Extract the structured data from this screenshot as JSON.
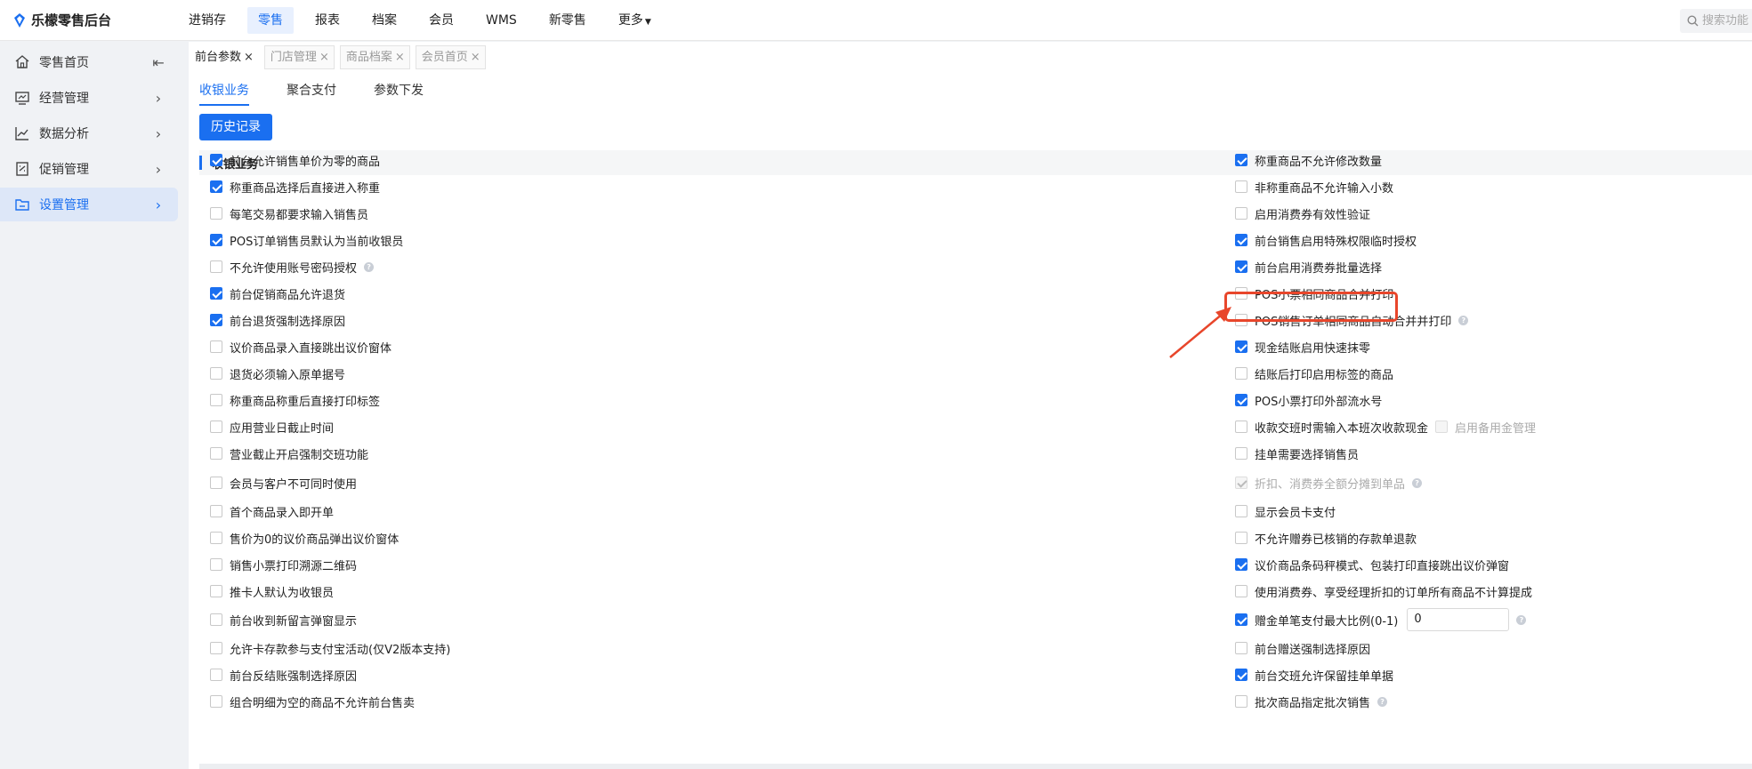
{
  "app": {
    "title": "乐檬零售后台"
  },
  "topnav": [
    {
      "label": "进销存",
      "active": false
    },
    {
      "label": "零售",
      "active": true
    },
    {
      "label": "报表",
      "active": false
    },
    {
      "label": "档案",
      "active": false
    },
    {
      "label": "会员",
      "active": false
    },
    {
      "label": "WMS",
      "active": false
    },
    {
      "label": "新零售",
      "active": false
    },
    {
      "label": "更多",
      "active": false
    }
  ],
  "search": {
    "placeholder": "搜索功能"
  },
  "sidebar": {
    "items": [
      {
        "label": "零售首页",
        "icon": "home-icon"
      },
      {
        "label": "经营管理",
        "icon": "monitor-icon"
      },
      {
        "label": "数据分析",
        "icon": "chart-line-icon"
      },
      {
        "label": "促销管理",
        "icon": "promotion-icon"
      },
      {
        "label": "设置管理",
        "icon": "folder-settings-icon"
      }
    ]
  },
  "page_tabs": [
    {
      "label": "前台参数",
      "active": true
    },
    {
      "label": "门店管理",
      "active": false
    },
    {
      "label": "商品档案",
      "active": false
    },
    {
      "label": "会员首页",
      "active": false
    }
  ],
  "sub_tabs": [
    {
      "label": "收银业务",
      "active": true
    },
    {
      "label": "聚合支付",
      "active": false
    },
    {
      "label": "参数下发",
      "active": false
    }
  ],
  "history_button": "历史记录",
  "section_title": "收银业务",
  "left_settings": [
    {
      "label": "前台允许销售单价为零的商品",
      "checked": true
    },
    {
      "label": "称重商品选择后直接进入称重",
      "checked": true
    },
    {
      "label": "每笔交易都要求输入销售员",
      "checked": false
    },
    {
      "label": "POS订单销售员默认为当前收银员",
      "checked": true
    },
    {
      "label": "不允许使用账号密码授权",
      "checked": false
    },
    {
      "label": "前台促销商品允许退货",
      "checked": true
    },
    {
      "label": "前台退货强制选择原因",
      "checked": true
    },
    {
      "label": "议价商品录入直接跳出议价窗体",
      "checked": false
    },
    {
      "label": "退货必须输入原单据号",
      "checked": false
    },
    {
      "label": "称重商品称重后直接打印标签",
      "checked": false
    },
    {
      "label": "应用营业日截止时间",
      "checked": false
    },
    {
      "label": "营业截止开启强制交班功能",
      "checked": false
    },
    {
      "label": "会员与客户不可同时使用",
      "checked": false
    },
    {
      "label": "首个商品录入即开单",
      "checked": false
    },
    {
      "label": "售价为0的议价商品弹出议价窗体",
      "checked": false
    },
    {
      "label": "销售小票打印溯源二维码",
      "checked": false
    },
    {
      "label": "推卡人默认为收银员",
      "checked": false
    },
    {
      "label": "前台收到新留言弹窗显示",
      "checked": false
    },
    {
      "label": "允许卡存款参与支付宝活动(仅V2版本支持)",
      "checked": false
    },
    {
      "label": "前台反结账强制选择原因",
      "checked": false
    },
    {
      "label": "组合明细为空的商品不允许前台售卖",
      "checked": false
    }
  ],
  "right_settings": [
    {
      "label": "称重商品不允许修改数量",
      "checked": true
    },
    {
      "label": "非称重商品不允许输入小数",
      "checked": false
    },
    {
      "label": "启用消费券有效性验证",
      "checked": false
    },
    {
      "label": "前台销售启用特殊权限临时授权",
      "checked": true
    },
    {
      "label": "前台启用消费券批量选择",
      "checked": true
    },
    {
      "label": "POS小票相同商品合并打印",
      "checked": false
    },
    {
      "label": "POS销售订单相同商品自动合并并打印",
      "checked": false
    },
    {
      "label": "现金结账启用快速抹零",
      "checked": true
    },
    {
      "label": "结账后打印启用标签的商品",
      "checked": false
    },
    {
      "label": "POS小票打印外部流水号",
      "checked": true
    },
    {
      "label": "收款交班时需输入本班次收款现金",
      "checked": false,
      "extra": {
        "label": "启用备用金管理",
        "checked": false
      }
    },
    {
      "label": "挂单需要选择销售员",
      "checked": false
    },
    {
      "label": "折扣、消费券全额分摊到单品",
      "checked": true
    },
    {
      "label": "显示会员卡支付",
      "checked": false
    },
    {
      "label": "不允许赠券已核销的存款单退款",
      "checked": false
    },
    {
      "label": "议价商品条码秤模式、包装打印直接跳出议价弹窗",
      "checked": true
    },
    {
      "label": "使用消费券、享受经理折扣的订单所有商品不计算提成",
      "checked": false
    },
    {
      "label": "赠金单笔支付最大比例(0-1)",
      "checked": true,
      "input_value": "0"
    },
    {
      "label": "前台赠送强制选择原因",
      "checked": false
    },
    {
      "label": "前台交班允许保留挂单单据",
      "checked": true
    },
    {
      "label": "批次商品指定批次销售",
      "checked": false
    }
  ],
  "highlight": {
    "target": "前台启用消费券批量选择",
    "color": "#e8462b"
  },
  "colors": {
    "accent": "#1a6ff0",
    "annotation": "#e8462b"
  }
}
